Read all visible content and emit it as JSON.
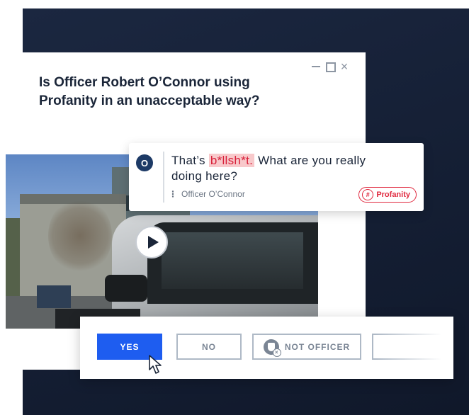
{
  "window": {
    "minimize_label": "–",
    "maximize_label": "",
    "close_label": "×"
  },
  "question": {
    "text": "Is Officer Robert O’Connor using Profanity in an unacceptable way?"
  },
  "video": {
    "play_icon": "play-icon"
  },
  "transcript": {
    "avatar_letter": "O",
    "quote_before": "That’s ",
    "flagged_word": "b*llsh*t.",
    "quote_after": " What are you really doing here?",
    "speaker": "Officer O’Connor",
    "badge_label": "Profanity",
    "badge_icon_text": "#"
  },
  "answers": {
    "yes_label": "YES",
    "no_label": "NO",
    "not_officer_label": "NOT OFFICER"
  },
  "colors": {
    "background_navy": "#141e33",
    "primary_blue": "#1e5df0",
    "flag_red": "#e0283e",
    "avatar_navy": "#1d3a66"
  }
}
